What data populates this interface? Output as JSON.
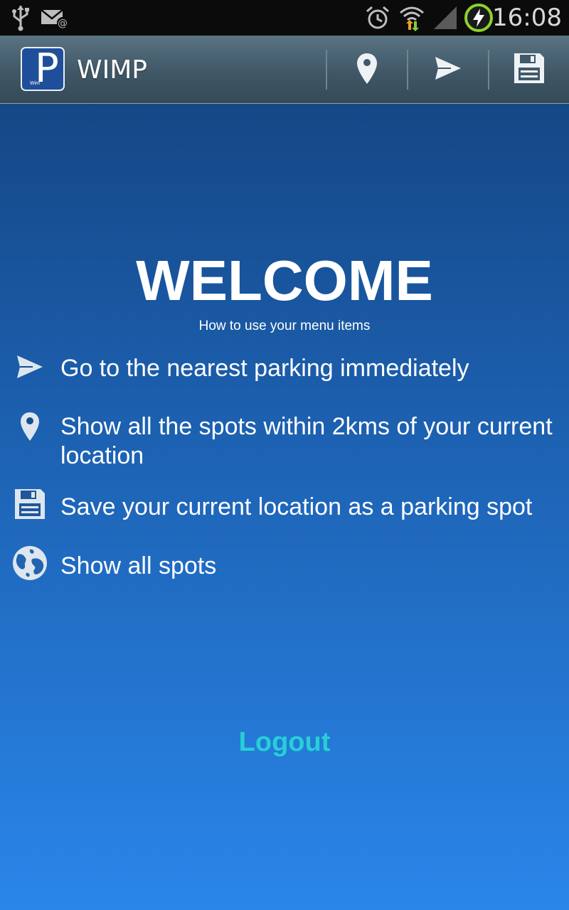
{
  "status_bar": {
    "time": "16:08",
    "icons": [
      "usb-icon",
      "email-icon",
      "alarm-icon",
      "wifi-icon",
      "signal-icon",
      "battery-charging-icon"
    ]
  },
  "action_bar": {
    "title": "WIMP",
    "logo_letter": "P",
    "logo_small_text": "Wim",
    "actions": [
      "location-pin-icon",
      "send-icon",
      "save-icon"
    ]
  },
  "main": {
    "title": "WELCOME",
    "subtitle": "How to use your menu items",
    "items": [
      {
        "icon": "send-icon",
        "label": "Go to the nearest parking immediately"
      },
      {
        "icon": "location-pin-icon",
        "label": "Show all the spots within 2kms of your current location"
      },
      {
        "icon": "save-icon",
        "label": "Save your current location as a parking spot"
      },
      {
        "icon": "globe-icon",
        "label": "Show all spots"
      }
    ],
    "logout_label": "Logout"
  },
  "colors": {
    "background_top": "#123f78",
    "background_bottom": "#2a86ea",
    "action_bar": "#3f5766",
    "logout": "#25d0d6"
  }
}
